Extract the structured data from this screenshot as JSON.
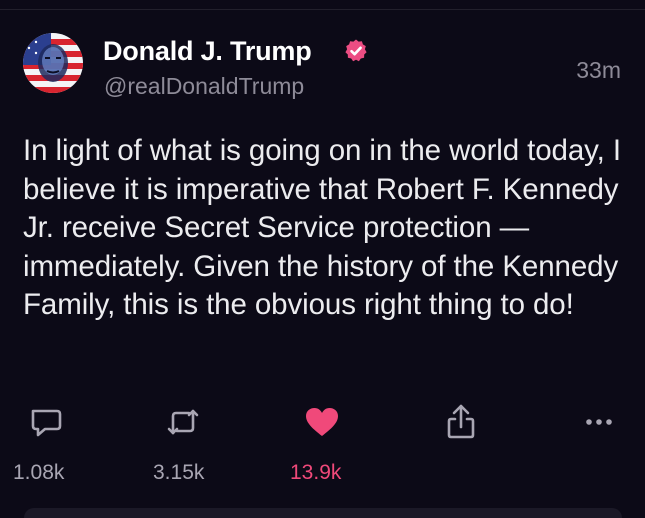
{
  "post": {
    "author": {
      "display_name": "Donald J. Trump",
      "handle": "@realDonaldTrump",
      "verified": true,
      "avatar_icon": "american-flag-portrait-avatar"
    },
    "timestamp": "33m",
    "text": "In light of what is going on in the world today, I believe it is imperative that Robert F. Kennedy Jr. receive Secret Service protection — immediately. Given the history of the Kennedy Family, this is the obvious right thing to do!"
  },
  "actions": {
    "reply": {
      "icon": "speech-bubble-icon",
      "count": "1.08k"
    },
    "repost": {
      "icon": "repost-arrows-icon",
      "count": "3.15k"
    },
    "like": {
      "icon": "heart-icon",
      "count": "13.9k",
      "active": true
    },
    "share": {
      "icon": "share-upload-icon"
    },
    "more": {
      "icon": "more-dots-icon"
    }
  },
  "colors": {
    "background": "#0c0a17",
    "text_primary": "#ffffff",
    "text_secondary": "#8e8b98",
    "like_accent": "#f0497a",
    "verified_badge": "#ec4d83"
  }
}
